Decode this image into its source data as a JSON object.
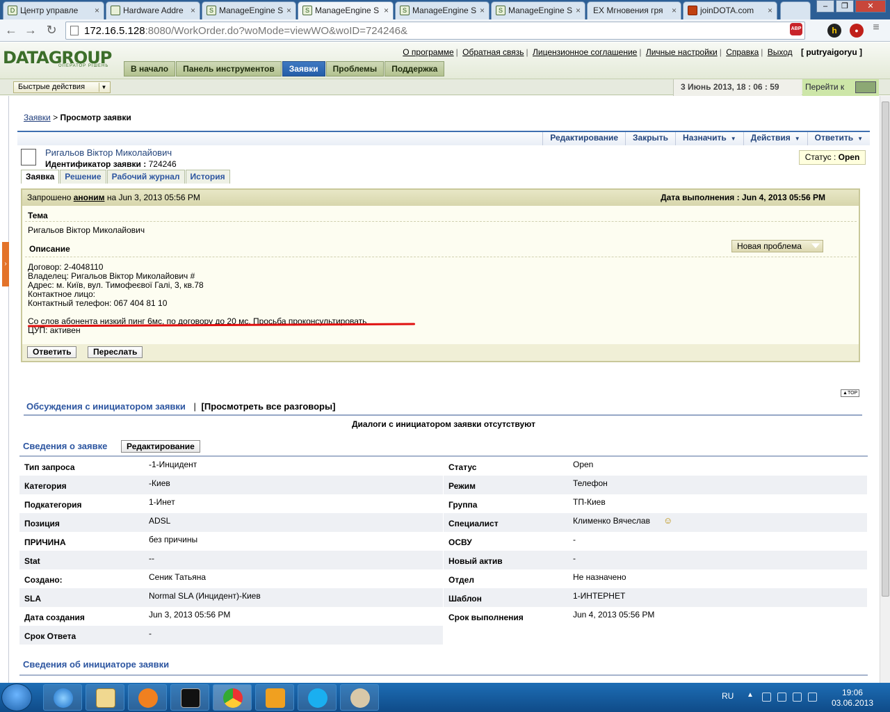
{
  "browser": {
    "tabs": [
      {
        "label": "Центр управле"
      },
      {
        "label": "Hardware Addre"
      },
      {
        "label": "ManageEngine S"
      },
      {
        "label": "ManageEngine S"
      },
      {
        "label": "ManageEngine S"
      },
      {
        "label": "ManageEngine S"
      },
      {
        "label": "EX Мгновения гря"
      },
      {
        "label": "joinDOTA.com"
      }
    ],
    "url_host": "172.16.5.128",
    "url_rest": ":8080/WorkOrder.do?woMode=viewWO&woID=724246&"
  },
  "app": {
    "logo": "DATAGROUP",
    "logo_sub": "ОПЕРАТОР РІШЕНЬ",
    "top_links": [
      "О программе",
      "Обратная связь",
      "Лицензионное соглашение",
      "Личные настройки",
      "Справка",
      "Выход"
    ],
    "user": "[ putryaigoryu ]",
    "main_tabs": [
      "В начало",
      "Панель инструментов",
      "Заявки",
      "Проблемы",
      "Поддержка"
    ],
    "quick_actions": "Быстрые действия",
    "datetime": "3 Июнь 2013, 18 : 06 : 59",
    "goto": "Перейти к"
  },
  "breadcrumb": {
    "link": "Заявки",
    "sep": ">",
    "current": "Просмотр заявки"
  },
  "actions": {
    "edit": "Редактирование",
    "close": "Закрыть",
    "assign": "Назначить",
    "actions": "Действия",
    "reply": "Ответить"
  },
  "request": {
    "requester_name": "Ригальов Віктор Миколайович",
    "id_label": "Идентификатор заявки :",
    "id_value": "724246",
    "status_label": "Статус :",
    "status_value": "Open",
    "subtabs": [
      "Заявка",
      "Решение",
      "Рабочий журнал",
      "История"
    ],
    "requested_by_prefix": "Запрошено",
    "requested_by": "аноним",
    "requested_on": "на Jun 3, 2013 05:56 PM",
    "due_label": "Дата выполнения :",
    "due_value": "Jun 4, 2013 05:56 PM",
    "subject_label": "Тема",
    "subject_value": "Ригальов Віктор Миколайович",
    "description_label": "Описание",
    "problem_button": "Новая проблема",
    "description_lines": [
      "Договор: 2-4048110",
      "Владелец: Ригальов Віктор Миколайович #",
      "Адрес: м. Київ, вул. Тимофеєвої Галі, 3, кв.78",
      "Контактное лицо:",
      "Контактный телефон: 067 404 81 10"
    ],
    "description_highlight": "Со слов абонента низкий пинг 6мс, по договору до 20 мс. Просьба проконсультировать",
    "description_last": "ЦУП: активен",
    "reply_button": "Ответить",
    "forward_button": "Переслать"
  },
  "top_link": "TOP",
  "discussions": {
    "title": "Обсуждения с инициатором заявки",
    "sep": "|",
    "view_all": "[Просмотреть все разговоры]",
    "empty": "Диалоги с инициатором заявки отсутствуют"
  },
  "details": {
    "title": "Сведения о заявке",
    "edit_button": "Редактирование",
    "left": [
      {
        "k": "Тип запроса",
        "v": "-1-Инцидент"
      },
      {
        "k": "Категория",
        "v": "-Киев"
      },
      {
        "k": "Подкатегория",
        "v": "1-Инет"
      },
      {
        "k": "Позиция",
        "v": "ADSL"
      },
      {
        "k": "ПРИЧИНА",
        "v": "без причины"
      },
      {
        "k": "Stat",
        "v": "--"
      },
      {
        "k": "Создано:",
        "v": "Сеник Татьяна"
      },
      {
        "k": "SLA",
        "v": "Normal SLA (Инцидент)-Киев"
      },
      {
        "k": "Дата создания",
        "v": "Jun 3, 2013 05:56 PM"
      },
      {
        "k": "Срок Ответа",
        "v": "-"
      }
    ],
    "right": [
      {
        "k": "Статус",
        "v": "Open"
      },
      {
        "k": "Режим",
        "v": "Телефон"
      },
      {
        "k": "Группа",
        "v": "ТП-Киев"
      },
      {
        "k": "Специалист",
        "v": "Клименко Вячеслав"
      },
      {
        "k": "ОСВУ",
        "v": "-"
      },
      {
        "k": "Новый актив",
        "v": "-"
      },
      {
        "k": "Отдел",
        "v": "Не назначено"
      },
      {
        "k": "Шаблон",
        "v": "1-ИНТЕРНЕТ"
      },
      {
        "k": "Срок выполнения",
        "v": "Jun 4, 2013 05:56 PM"
      }
    ]
  },
  "initiator_title": "Сведения об инициаторе заявки",
  "taskbar": {
    "lang": "RU",
    "time": "19:06",
    "date": "03.06.2013"
  }
}
